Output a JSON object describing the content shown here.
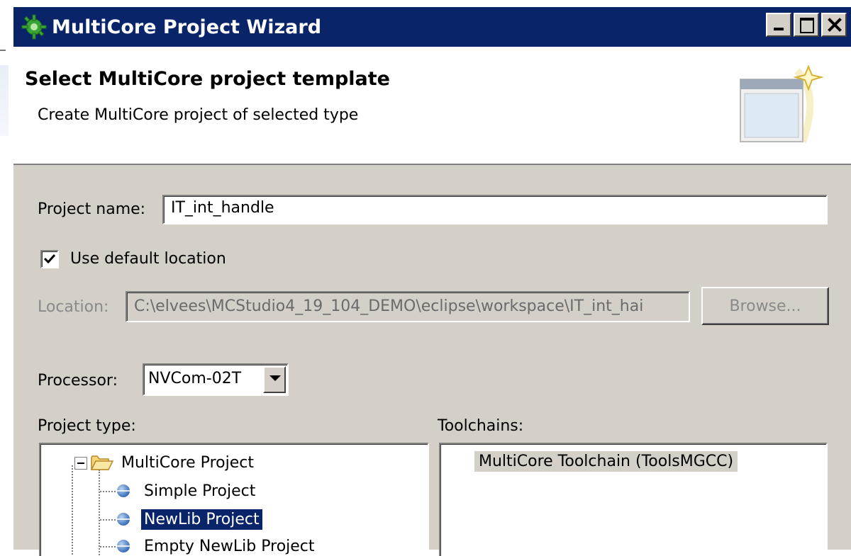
{
  "window": {
    "title": "MultiCore Project Wizard"
  },
  "header": {
    "title": "Select MultiCore project template",
    "description": "Create MultiCore project of selected type"
  },
  "form": {
    "project_name_label": "Project name:",
    "project_name_value": "IT_int_handle",
    "use_default_location_label": "Use default location",
    "use_default_location_checked": true,
    "location_label": "Location:",
    "location_value": "C:\\elvees\\MCStudio4_19_104_DEMO\\eclipse\\workspace\\IT_int_hai",
    "browse_label": "Browse...",
    "processor_label": "Processor:",
    "processor_value": "NVCom-02T",
    "project_type_label": "Project type:",
    "toolchains_label": "Toolchains:"
  },
  "project_tree": {
    "root": {
      "label": "MultiCore Project",
      "icon": "folder-open-icon",
      "expanded": true
    },
    "children": [
      {
        "label": "Simple Project",
        "icon": "blue-sphere-icon",
        "selected": false
      },
      {
        "label": "NewLib Project",
        "icon": "blue-sphere-icon",
        "selected": true
      },
      {
        "label": "Empty NewLib Project",
        "icon": "blue-sphere-icon",
        "selected": false
      }
    ]
  },
  "toolchains": {
    "items": [
      {
        "label": "MultiCore Toolchain (ToolsMGCC)"
      }
    ]
  },
  "colors": {
    "titlebar": "#0a246a",
    "dialog_bg": "#d4d0c8",
    "selection": "#0a246a"
  }
}
